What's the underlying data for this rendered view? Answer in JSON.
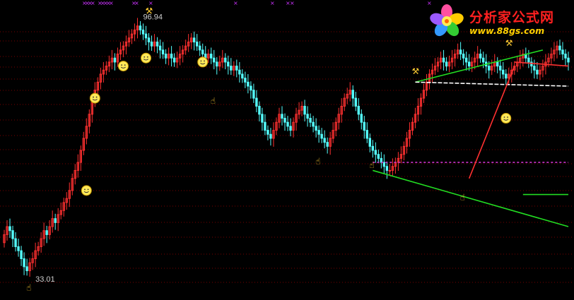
{
  "chart_data": {
    "type": "candlestick",
    "ylim": [
      30,
      100
    ],
    "colors": {
      "up": "#ff3030",
      "down": "#54ffff",
      "trend": "#22dd22",
      "wedge": "#ff3030",
      "level": "#ffffff",
      "dashed_level": "#cc33cc",
      "grid": "#7a0000",
      "marker": "#ffcc33"
    },
    "annotations": {
      "high_label": "96.94",
      "low_label": "33.01"
    },
    "x": [
      1,
      2,
      3,
      4,
      5,
      6,
      7,
      8,
      9,
      10,
      11,
      12,
      13,
      14,
      15,
      16,
      17,
      18,
      19,
      20,
      21,
      22,
      23,
      24,
      25,
      26,
      27,
      28,
      29,
      30,
      31,
      32,
      33,
      34,
      35,
      36,
      37,
      38,
      39,
      40,
      41,
      42,
      43,
      44,
      45,
      46,
      47,
      48,
      49,
      50,
      51,
      52,
      53,
      54,
      55,
      56,
      57,
      58,
      59,
      60,
      61,
      62,
      63,
      64,
      65,
      66,
      67,
      68,
      69,
      70,
      71,
      72,
      73,
      74,
      75,
      76,
      77,
      78,
      79,
      80,
      81,
      82,
      83,
      84,
      85,
      86,
      87,
      88,
      89,
      90,
      91,
      92,
      93,
      94,
      95,
      96,
      97,
      98,
      99,
      100,
      101,
      102,
      103,
      104,
      105,
      106,
      107,
      108,
      109,
      110,
      111,
      112,
      113,
      114,
      115,
      116,
      117,
      118,
      119,
      120,
      121,
      122,
      123,
      124,
      125,
      126,
      127,
      128,
      129,
      130,
      131,
      132,
      133,
      134,
      135,
      136,
      137,
      138,
      139,
      140,
      141,
      142,
      143,
      144,
      145,
      146,
      147,
      148,
      149,
      150,
      151,
      152,
      153,
      154,
      155,
      156,
      157,
      158,
      159,
      160,
      161,
      162,
      163,
      164,
      165,
      166,
      167,
      168,
      169,
      170,
      171,
      172,
      173,
      174,
      175,
      176,
      177,
      178,
      179,
      180,
      181,
      182,
      183,
      184,
      185,
      186,
      187,
      188,
      189,
      190,
      191,
      192,
      193,
      194,
      195,
      196,
      197,
      198,
      199,
      200
    ],
    "series": [
      {
        "name": "open",
        "values": [
          42,
          44,
          46,
          45,
          43,
          41,
          40,
          38,
          36,
          35,
          37,
          38,
          40,
          41,
          43,
          45,
          44,
          46,
          48,
          47,
          49,
          50,
          52,
          53,
          55,
          58,
          60,
          62,
          65,
          68,
          71,
          74,
          77,
          80,
          82,
          84,
          85,
          86,
          87,
          88,
          87,
          89,
          90,
          91,
          92,
          93,
          94,
          95,
          96,
          95,
          94,
          93,
          92,
          91,
          92,
          91,
          90,
          89,
          88,
          89,
          88,
          87,
          88,
          89,
          90,
          91,
          92,
          93,
          92,
          91,
          90,
          89,
          88,
          89,
          88,
          87,
          86,
          87,
          88,
          87,
          86,
          85,
          86,
          85,
          84,
          83,
          82,
          81,
          80,
          78,
          76,
          74,
          72,
          70,
          69,
          68,
          70,
          72,
          74,
          73,
          72,
          71,
          70,
          72,
          74,
          75,
          76,
          74,
          73,
          72,
          71,
          70,
          69,
          68,
          67,
          66,
          68,
          70,
          72,
          74,
          76,
          78,
          79,
          80,
          78,
          76,
          74,
          72,
          70,
          68,
          66,
          65,
          64,
          63,
          62,
          61,
          60,
          60,
          61,
          62,
          63,
          64,
          66,
          68,
          70,
          72,
          74,
          76,
          78,
          80,
          82,
          84,
          85,
          86,
          87,
          88,
          87,
          86,
          87,
          88,
          89,
          90,
          89,
          88,
          87,
          86,
          87,
          88,
          89,
          88,
          87,
          86,
          85,
          86,
          87,
          86,
          85,
          84,
          83,
          84,
          85,
          86,
          87,
          88,
          89,
          88,
          87,
          86,
          85,
          84,
          85,
          86,
          87,
          88,
          89,
          90,
          91,
          90,
          89,
          88
        ],
        "display_note": ""
      },
      {
        "name": "close",
        "values": [
          44,
          46,
          45,
          43,
          41,
          40,
          38,
          36,
          35,
          37,
          38,
          40,
          41,
          43,
          45,
          44,
          46,
          48,
          47,
          49,
          50,
          52,
          53,
          55,
          58,
          60,
          62,
          65,
          68,
          71,
          74,
          77,
          80,
          82,
          84,
          85,
          86,
          87,
          88,
          87,
          89,
          90,
          91,
          92,
          93,
          94,
          95,
          96,
          95,
          94,
          93,
          92,
          91,
          92,
          91,
          90,
          89,
          88,
          89,
          88,
          87,
          88,
          89,
          90,
          91,
          92,
          93,
          92,
          91,
          90,
          89,
          88,
          89,
          88,
          87,
          86,
          87,
          88,
          87,
          86,
          85,
          86,
          85,
          84,
          83,
          82,
          81,
          80,
          78,
          76,
          74,
          72,
          70,
          69,
          68,
          70,
          72,
          74,
          73,
          72,
          71,
          70,
          72,
          74,
          75,
          76,
          74,
          73,
          72,
          71,
          70,
          69,
          68,
          67,
          66,
          68,
          70,
          72,
          74,
          76,
          78,
          79,
          80,
          78,
          76,
          74,
          72,
          70,
          68,
          66,
          65,
          64,
          63,
          62,
          61,
          60,
          60,
          61,
          62,
          63,
          64,
          66,
          68,
          70,
          72,
          74,
          76,
          78,
          80,
          82,
          84,
          85,
          86,
          87,
          88,
          87,
          86,
          87,
          88,
          89,
          90,
          89,
          88,
          87,
          86,
          87,
          88,
          89,
          88,
          87,
          86,
          85,
          86,
          87,
          86,
          85,
          84,
          83,
          84,
          85,
          86,
          87,
          88,
          89,
          88,
          87,
          86,
          85,
          84,
          85,
          86,
          87,
          88,
          89,
          90,
          91,
          90,
          89,
          88,
          87
        ],
        "display_note": ""
      }
    ]
  }
}
